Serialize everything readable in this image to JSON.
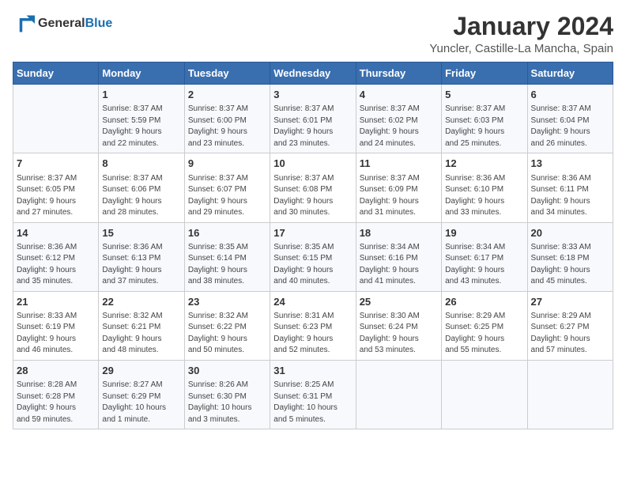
{
  "header": {
    "logo_general": "General",
    "logo_blue": "Blue",
    "month": "January 2024",
    "location": "Yuncler, Castille-La Mancha, Spain"
  },
  "weekdays": [
    "Sunday",
    "Monday",
    "Tuesday",
    "Wednesday",
    "Thursday",
    "Friday",
    "Saturday"
  ],
  "weeks": [
    [
      {
        "day": "",
        "info": ""
      },
      {
        "day": "1",
        "info": "Sunrise: 8:37 AM\nSunset: 5:59 PM\nDaylight: 9 hours\nand 22 minutes."
      },
      {
        "day": "2",
        "info": "Sunrise: 8:37 AM\nSunset: 6:00 PM\nDaylight: 9 hours\nand 23 minutes."
      },
      {
        "day": "3",
        "info": "Sunrise: 8:37 AM\nSunset: 6:01 PM\nDaylight: 9 hours\nand 23 minutes."
      },
      {
        "day": "4",
        "info": "Sunrise: 8:37 AM\nSunset: 6:02 PM\nDaylight: 9 hours\nand 24 minutes."
      },
      {
        "day": "5",
        "info": "Sunrise: 8:37 AM\nSunset: 6:03 PM\nDaylight: 9 hours\nand 25 minutes."
      },
      {
        "day": "6",
        "info": "Sunrise: 8:37 AM\nSunset: 6:04 PM\nDaylight: 9 hours\nand 26 minutes."
      }
    ],
    [
      {
        "day": "7",
        "info": "Sunrise: 8:37 AM\nSunset: 6:05 PM\nDaylight: 9 hours\nand 27 minutes."
      },
      {
        "day": "8",
        "info": "Sunrise: 8:37 AM\nSunset: 6:06 PM\nDaylight: 9 hours\nand 28 minutes."
      },
      {
        "day": "9",
        "info": "Sunrise: 8:37 AM\nSunset: 6:07 PM\nDaylight: 9 hours\nand 29 minutes."
      },
      {
        "day": "10",
        "info": "Sunrise: 8:37 AM\nSunset: 6:08 PM\nDaylight: 9 hours\nand 30 minutes."
      },
      {
        "day": "11",
        "info": "Sunrise: 8:37 AM\nSunset: 6:09 PM\nDaylight: 9 hours\nand 31 minutes."
      },
      {
        "day": "12",
        "info": "Sunrise: 8:36 AM\nSunset: 6:10 PM\nDaylight: 9 hours\nand 33 minutes."
      },
      {
        "day": "13",
        "info": "Sunrise: 8:36 AM\nSunset: 6:11 PM\nDaylight: 9 hours\nand 34 minutes."
      }
    ],
    [
      {
        "day": "14",
        "info": "Sunrise: 8:36 AM\nSunset: 6:12 PM\nDaylight: 9 hours\nand 35 minutes."
      },
      {
        "day": "15",
        "info": "Sunrise: 8:36 AM\nSunset: 6:13 PM\nDaylight: 9 hours\nand 37 minutes."
      },
      {
        "day": "16",
        "info": "Sunrise: 8:35 AM\nSunset: 6:14 PM\nDaylight: 9 hours\nand 38 minutes."
      },
      {
        "day": "17",
        "info": "Sunrise: 8:35 AM\nSunset: 6:15 PM\nDaylight: 9 hours\nand 40 minutes."
      },
      {
        "day": "18",
        "info": "Sunrise: 8:34 AM\nSunset: 6:16 PM\nDaylight: 9 hours\nand 41 minutes."
      },
      {
        "day": "19",
        "info": "Sunrise: 8:34 AM\nSunset: 6:17 PM\nDaylight: 9 hours\nand 43 minutes."
      },
      {
        "day": "20",
        "info": "Sunrise: 8:33 AM\nSunset: 6:18 PM\nDaylight: 9 hours\nand 45 minutes."
      }
    ],
    [
      {
        "day": "21",
        "info": "Sunrise: 8:33 AM\nSunset: 6:19 PM\nDaylight: 9 hours\nand 46 minutes."
      },
      {
        "day": "22",
        "info": "Sunrise: 8:32 AM\nSunset: 6:21 PM\nDaylight: 9 hours\nand 48 minutes."
      },
      {
        "day": "23",
        "info": "Sunrise: 8:32 AM\nSunset: 6:22 PM\nDaylight: 9 hours\nand 50 minutes."
      },
      {
        "day": "24",
        "info": "Sunrise: 8:31 AM\nSunset: 6:23 PM\nDaylight: 9 hours\nand 52 minutes."
      },
      {
        "day": "25",
        "info": "Sunrise: 8:30 AM\nSunset: 6:24 PM\nDaylight: 9 hours\nand 53 minutes."
      },
      {
        "day": "26",
        "info": "Sunrise: 8:29 AM\nSunset: 6:25 PM\nDaylight: 9 hours\nand 55 minutes."
      },
      {
        "day": "27",
        "info": "Sunrise: 8:29 AM\nSunset: 6:27 PM\nDaylight: 9 hours\nand 57 minutes."
      }
    ],
    [
      {
        "day": "28",
        "info": "Sunrise: 8:28 AM\nSunset: 6:28 PM\nDaylight: 9 hours\nand 59 minutes."
      },
      {
        "day": "29",
        "info": "Sunrise: 8:27 AM\nSunset: 6:29 PM\nDaylight: 10 hours\nand 1 minute."
      },
      {
        "day": "30",
        "info": "Sunrise: 8:26 AM\nSunset: 6:30 PM\nDaylight: 10 hours\nand 3 minutes."
      },
      {
        "day": "31",
        "info": "Sunrise: 8:25 AM\nSunset: 6:31 PM\nDaylight: 10 hours\nand 5 minutes."
      },
      {
        "day": "",
        "info": ""
      },
      {
        "day": "",
        "info": ""
      },
      {
        "day": "",
        "info": ""
      }
    ]
  ]
}
